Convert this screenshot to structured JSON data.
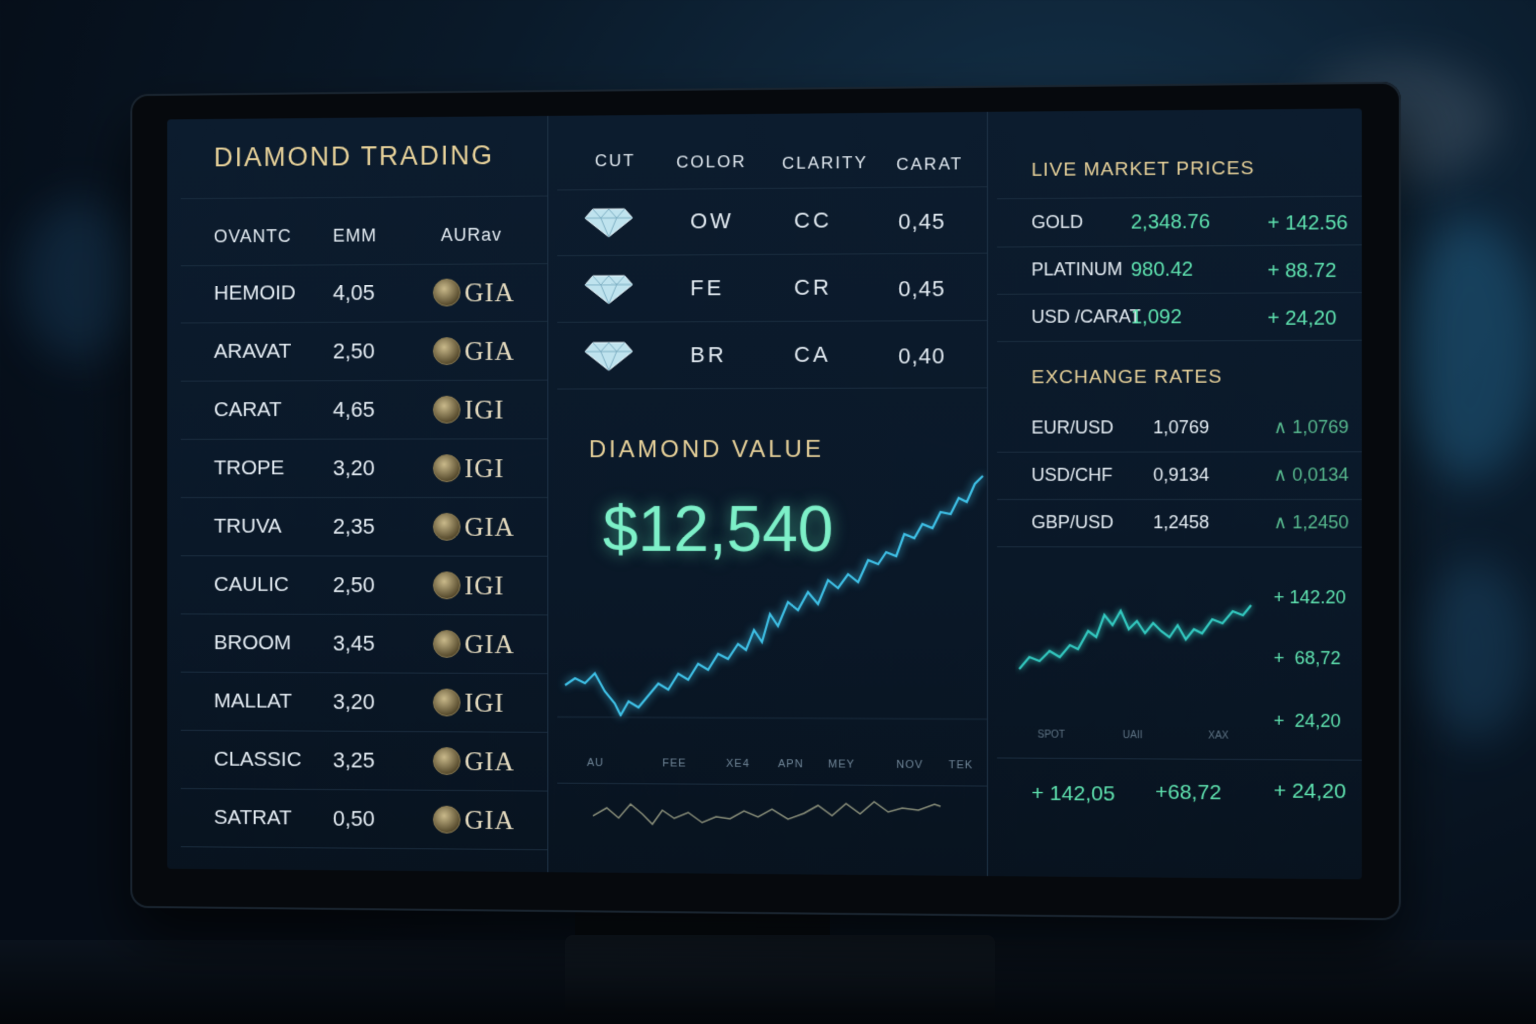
{
  "app": {
    "title": "DIAMOND TRADING"
  },
  "trading_table": {
    "headers": [
      "OVANTC",
      "EMM",
      "AURav"
    ],
    "rows": [
      {
        "name": "HEMOID",
        "value": "4,05",
        "cert": "GIA"
      },
      {
        "name": "ARAVAT",
        "value": "2,50",
        "cert": "GIA"
      },
      {
        "name": "CARAT",
        "value": "4,65",
        "cert": "IGI"
      },
      {
        "name": "TROPE",
        "value": "3,20",
        "cert": "IGI"
      },
      {
        "name": "TRUVA",
        "value": "2,35",
        "cert": "GIA"
      },
      {
        "name": "CAULIC",
        "value": "2,50",
        "cert": "IGI"
      },
      {
        "name": "BROOM",
        "value": "3,45",
        "cert": "GIA"
      },
      {
        "name": "MALLAT",
        "value": "3,20",
        "cert": "IGI"
      },
      {
        "name": "CLASSIC",
        "value": "3,25",
        "cert": "GIA"
      },
      {
        "name": "SATRAT",
        "value": "0,50",
        "cert": "GIA"
      }
    ]
  },
  "grading_table": {
    "headers": [
      "CUT",
      "COLOR",
      "CLARITY",
      "CARAT"
    ],
    "rows": [
      {
        "cut_icon": "diamond-icon",
        "color": "OW",
        "clarity": "CC",
        "carat": "0,45"
      },
      {
        "cut_icon": "diamond-icon",
        "color": "FE",
        "clarity": "CR",
        "carat": "0,45"
      },
      {
        "cut_icon": "diamond-icon",
        "color": "BR",
        "clarity": "CA",
        "carat": "0,40"
      }
    ]
  },
  "diamond_value": {
    "title": "DIAMOND VALUE",
    "amount": "$12,540",
    "x_labels": [
      "AU",
      "FEE",
      "XE4",
      "APN",
      "MEY",
      "NOV",
      "TEK"
    ]
  },
  "live_market": {
    "title": "LIVE MARKET PRICES",
    "rows": [
      {
        "name": "GOLD",
        "price": "2,348.76",
        "change": "+ 142.56"
      },
      {
        "name": "PLATINUM",
        "price": "980.42",
        "change": "+ 88.72"
      },
      {
        "name": "USD /CARAT",
        "price": "1,092",
        "change": "+ 24,20"
      }
    ]
  },
  "exchange_rates": {
    "title": "EXCHANGE RATES",
    "rows": [
      {
        "pair": "EUR/USD",
        "rate": "1,0769",
        "change": "∧ 1,0769"
      },
      {
        "pair": "USD/CHF",
        "rate": "0,9134",
        "change": "∧ 0,0134"
      },
      {
        "pair": "GBP/USD",
        "rate": "1,2458",
        "change": "∧ 1,2450"
      }
    ]
  },
  "mini_chart": {
    "side_values": [
      "+ 142.20",
      "+  68,72",
      "+  24,20"
    ],
    "x_labels": [
      "SPOT",
      "UAII",
      "XAX"
    ]
  },
  "footer_values": [
    "+ 142,05",
    "+68,72",
    "+ 24,20"
  ],
  "colors": {
    "accent_gold": "#e8d29a",
    "accent_green": "#5fe3b0",
    "chart_line": "#3fc2e8"
  }
}
